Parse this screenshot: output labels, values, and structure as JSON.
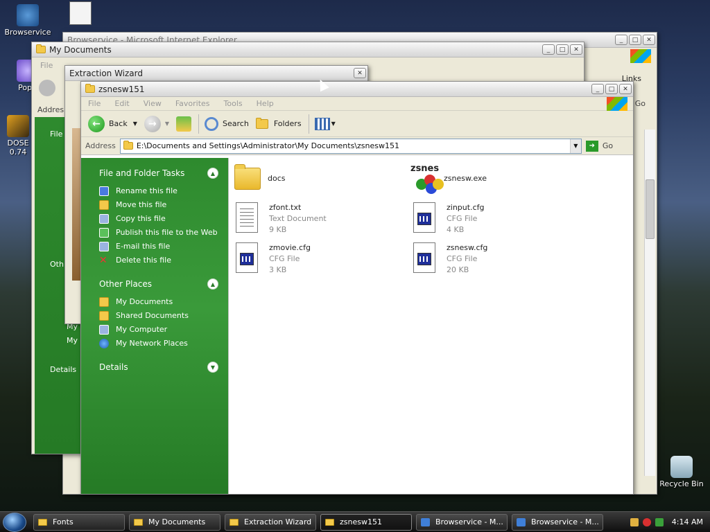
{
  "desktop": {
    "icons": [
      {
        "label": "Browservice"
      },
      {
        "label": "PopC"
      },
      {
        "label": "DOSE"
      },
      {
        "label": "0.74"
      },
      {
        "label": "Recycle Bin"
      }
    ]
  },
  "windows": {
    "ie": {
      "title": "Browservice - Microsoft Internet Explorer",
      "links_label": "Links",
      "go_label": "Go"
    },
    "my_documents": {
      "title": "My Documents",
      "menu_file": "File",
      "address_label": "Addres",
      "partial_texts": [
        "File",
        "Oth",
        "My",
        "My",
        "Details"
      ]
    },
    "extraction": {
      "title": "Extraction Wizard"
    }
  },
  "main": {
    "title": "zsnesw151",
    "menu": [
      "File",
      "Edit",
      "View",
      "Favorites",
      "Tools",
      "Help"
    ],
    "toolbar": {
      "back": "Back",
      "search": "Search",
      "folders": "Folders"
    },
    "address": {
      "label": "Address",
      "path": "E:\\Documents and Settings\\Administrator\\My Documents\\zsnesw151",
      "go": "Go"
    },
    "taskpane": {
      "file_tasks": {
        "heading": "File and Folder Tasks",
        "items": [
          "Rename this file",
          "Move this file",
          "Copy this file",
          "Publish this file to the Web",
          "E-mail this file",
          "Delete this file"
        ]
      },
      "other_places": {
        "heading": "Other Places",
        "items": [
          "My Documents",
          "Shared Documents",
          "My Computer",
          "My Network Places"
        ]
      },
      "details": {
        "heading": "Details"
      }
    },
    "files": [
      {
        "name": "docs",
        "type": "",
        "size": "",
        "icon": "folder-icon"
      },
      {
        "name": "zsnesw.exe",
        "type": "",
        "size": "",
        "icon": "zsnes-app-icon"
      },
      {
        "name": "zfont.txt",
        "type": "Text Document",
        "size": "9 KB",
        "icon": "text-document-icon"
      },
      {
        "name": "zinput.cfg",
        "type": "CFG File",
        "size": "4 KB",
        "icon": "cfg-file-icon"
      },
      {
        "name": "zmovie.cfg",
        "type": "CFG File",
        "size": "3 KB",
        "icon": "cfg-file-icon"
      },
      {
        "name": "zsnesw.cfg",
        "type": "CFG File",
        "size": "20 KB",
        "icon": "cfg-file-icon"
      }
    ],
    "zsnes_logo_text": "zsnes"
  },
  "taskbar": {
    "buttons": [
      "Fonts",
      "My Documents",
      "Extraction Wizard",
      "zsnesw151",
      "Browservice - M...",
      "Browservice - M..."
    ],
    "clock": "4:14 AM"
  }
}
